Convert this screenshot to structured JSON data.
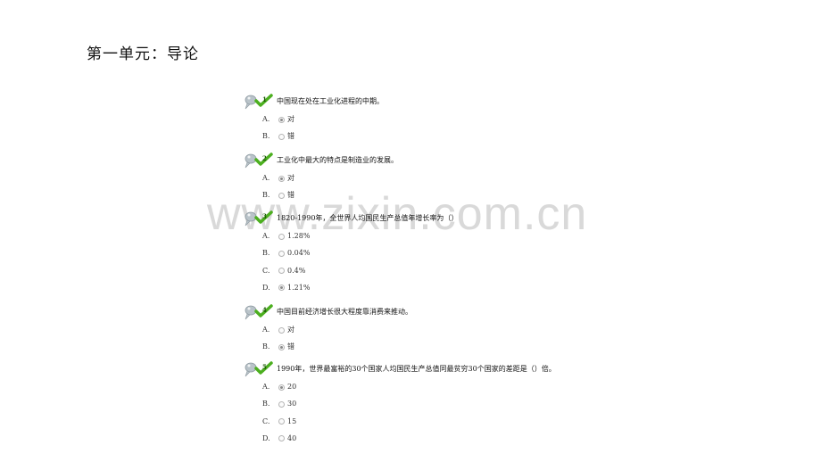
{
  "page_title": "第一单元：导论",
  "watermark": "www.zixin.com.cn",
  "colors": {
    "check_green": "#4caf1f",
    "pin_gray": "#b9c3c9"
  },
  "questions": [
    {
      "number": "1",
      "text": "中国现在处在工业化进程的中期。",
      "options": [
        {
          "letter": "A.",
          "label": "对",
          "selected": true
        },
        {
          "letter": "B.",
          "label": "错",
          "selected": false
        }
      ]
    },
    {
      "number": "2",
      "text": "工业化中最大的特点是制造业的发展。",
      "options": [
        {
          "letter": "A.",
          "label": "对",
          "selected": true
        },
        {
          "letter": "B.",
          "label": "错",
          "selected": false
        }
      ]
    },
    {
      "number": "3",
      "text": "1820-1990年，全世界人均国民生产总值年增长率为（）",
      "options": [
        {
          "letter": "A.",
          "label": "1.28%",
          "selected": false
        },
        {
          "letter": "B.",
          "label": "0.04%",
          "selected": false
        },
        {
          "letter": "C.",
          "label": "0.4%",
          "selected": false
        },
        {
          "letter": "D.",
          "label": "1.21%",
          "selected": true
        }
      ]
    },
    {
      "number": "4",
      "text": "中国目前经济增长很大程度靠消费来推动。",
      "options": [
        {
          "letter": "A.",
          "label": "对",
          "selected": false
        },
        {
          "letter": "B.",
          "label": "错",
          "selected": true
        }
      ]
    },
    {
      "number": "5",
      "text": "1990年，世界最富裕的30个国家人均国民生产总值同最贫穷30个国家的差距是（）倍。",
      "options": [
        {
          "letter": "A.",
          "label": "20",
          "selected": true
        },
        {
          "letter": "B.",
          "label": "30",
          "selected": false
        },
        {
          "letter": "C.",
          "label": "15",
          "selected": false
        },
        {
          "letter": "D.",
          "label": "40",
          "selected": false
        }
      ]
    }
  ]
}
